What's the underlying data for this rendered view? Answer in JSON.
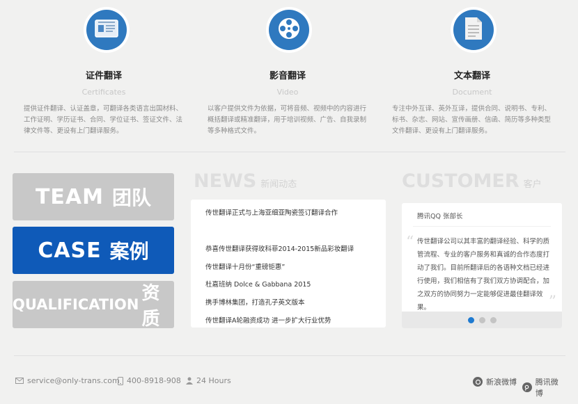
{
  "services": [
    {
      "icon": "id-card-icon",
      "title": "证件翻译",
      "subtitle": "Certificates",
      "description": "提供证件翻译、认证盖章，可翻译各类语言出国材料、工作证明、学历证书、合同、学位证书、签证文件、法律文件等、更设有上门翻译服务。"
    },
    {
      "icon": "film-reel-icon",
      "title": "影音翻译",
      "subtitle": "Video",
      "description": "以客户提供文件为依据，可将音频、视频中的内容进行概括翻译或精准翻译，用于培训视频、广告、自我录制等多种格式文件。"
    },
    {
      "icon": "document-icon",
      "title": "文本翻译",
      "subtitle": "Document",
      "description": "专注中外互译、英外互译，提供合同、说明书、专利、标书、杂志、网站、宣传画册、信函、简历等多种类型文件翻译、更设有上门翻译服务。"
    }
  ],
  "tiles": {
    "team": {
      "en": "TEAM",
      "cn": "团队"
    },
    "case": {
      "en": "CASE",
      "cn": "案例"
    },
    "qualification": {
      "en": "QUALIFICATION",
      "cn": "资质"
    }
  },
  "news": {
    "heading": "NEWS",
    "heading_cn": "新闻动态",
    "items": [
      "传世翻译正式与上海亚细亚陶瓷签订翻译合作",
      "恭喜传世翻译获得玫科菲2014-2015新品彩妆翻译",
      "传世翻译十月份“重磅钜惠”",
      "杜嘉班纳 Dolce & Gabbana 2015",
      "携手博林集团，打造孔子英文版本",
      "传世翻译A轮融资成功 进一步扩大行业优势"
    ]
  },
  "customer": {
    "heading": "CUSTOMER",
    "heading_cn": "客户",
    "who": "腾讯QQ  张部长",
    "quote": "传世翻译公司以其丰富的翻译经验、科学的质管流程、专业的客户服务和真诚的合作态度打动了我们。目前所翻译后的各语种文档已经进行使用，我们相信有了我们双方协调配合，加之双方的协同努力一定能够促进最佳翻译效果。",
    "slides": 3,
    "active_slide": 0
  },
  "footer": {
    "email": "service@only-trans.com",
    "phone": "400-8918-908",
    "hours": "24 Hours",
    "weibo_sina": "新浪微博",
    "weibo_tencent": "腾讯微博"
  },
  "colors": {
    "accent": "#0f5ab8",
    "icon_circle": "#2f79bf",
    "tile_inactive": "#c8c8c8",
    "dot_active": "#1e7ad0"
  }
}
